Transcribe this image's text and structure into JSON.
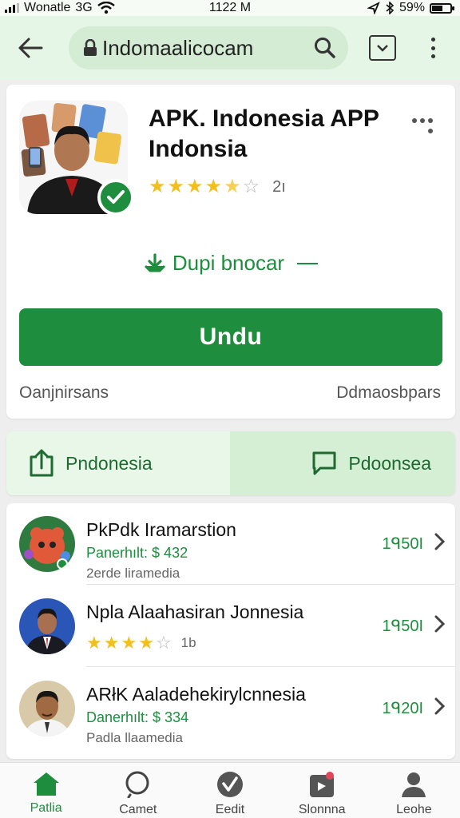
{
  "status_bar": {
    "carrier": "Wonatle",
    "network": "3G",
    "time": "1122 M",
    "battery": "59%",
    "battery_level": 0.59
  },
  "browser": {
    "url": "Indomaalicocam"
  },
  "app": {
    "title": "APK. Indonesia APP Indonsia",
    "rating_stars": 4.5,
    "rating_count": "2ı",
    "download_link_label": "Dupi bnocar",
    "install_label": "Undu",
    "meta_left": "Oanjnirsans",
    "meta_right": "Ddmaosbpars"
  },
  "tabs": [
    {
      "label": "Pndonesia",
      "icon": "share-icon"
    },
    {
      "label": "Pdoonsea",
      "icon": "comment-icon"
    }
  ],
  "list": [
    {
      "title": "PkPdk Iramarstion",
      "subtitle": "Panerhılt: $ 432",
      "subtitle2": "2erde liramedia",
      "count": "1ᑫ50I"
    },
    {
      "title": "Npla Alaahasiran Jonnesia",
      "stars": 4,
      "rating_count": "1b",
      "count": "1ᑫ50I"
    },
    {
      "title": "ARłK Aaladehekirylcnnesia",
      "subtitle": "Danerhılt: $ 334",
      "subtitle2": "Padla llaamedia",
      "count": "1ᑫ20I"
    }
  ],
  "bottom_nav": [
    {
      "label": "Patlia",
      "icon": "home-icon",
      "active": true
    },
    {
      "label": "Camet",
      "icon": "search-icon",
      "active": false
    },
    {
      "label": "Eedit",
      "icon": "edit-icon",
      "active": false
    },
    {
      "label": "Slonnna",
      "icon": "store-icon",
      "active": false
    },
    {
      "label": "Leohe",
      "icon": "profile-icon",
      "active": false
    }
  ],
  "colors": {
    "accent": "#1e8e3e",
    "browser_bar": "#e6f6e6",
    "star": "#f2c01e"
  }
}
